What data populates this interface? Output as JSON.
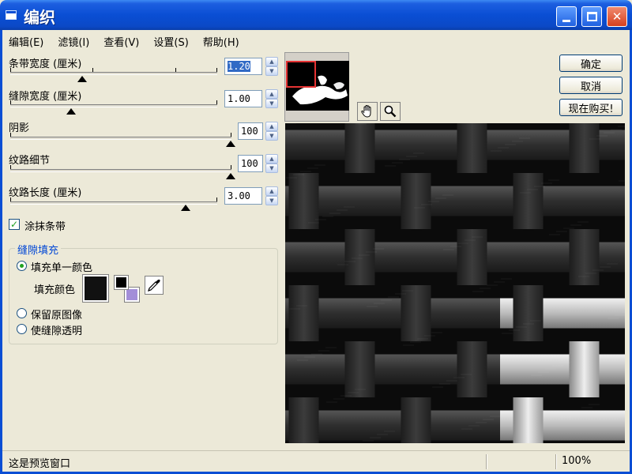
{
  "window": {
    "title": "编织",
    "accent_color": "#0a4ed4",
    "close_color": "#d6401f"
  },
  "menu": [
    "编辑(E)",
    "滤镜(I)",
    "查看(V)",
    "设置(S)",
    "帮助(H)"
  ],
  "controls": {
    "strip_width": {
      "label": "条带宽度 (厘米)",
      "value": "1.20",
      "level": 0.27
    },
    "gap_width": {
      "label": "缝隙宽度 (厘米)",
      "value": "1.00",
      "level": 0.23
    },
    "shadow": {
      "label": "阴影",
      "value": "100",
      "level": 1.0
    },
    "texture_detail": {
      "label": "纹路细节",
      "value": "100",
      "level": 1.0
    },
    "texture_length": {
      "label": "纹路长度 (厘米)",
      "value": "3.00",
      "level": 0.85
    }
  },
  "smear_strips": {
    "label": "涂抹条带",
    "checked": true
  },
  "gap_fill": {
    "title": "缝隙填充",
    "option_solid": "填充单一颜色",
    "fill_color_label": "填充颜色",
    "option_keep_original": "保留原图像",
    "option_transparent": "使缝隙透明",
    "selected": "option_solid",
    "fill_color": "#111111",
    "foreground_color": "#000000",
    "background_color": "#a38ed8"
  },
  "buttons": {
    "ok": "确定",
    "cancel": "取消",
    "buy_now": "现在购买!"
  },
  "tools": [
    "hand-icon",
    "zoom-icon"
  ],
  "status": {
    "message": "这是预览窗口",
    "zoom": "100%"
  }
}
